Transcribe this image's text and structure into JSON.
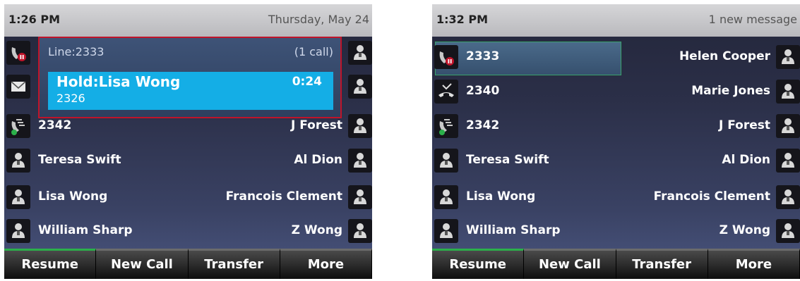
{
  "screens": [
    {
      "time": "1:26 PM",
      "status_info": "Thursday, May 24",
      "call": {
        "line_label": "Line:2333",
        "call_count": "(1 call)",
        "hold_name": "Hold:Lisa Wong",
        "hold_number": "2326",
        "duration": "0:24"
      },
      "rows": [
        {
          "left_icon": "line-hold-icon",
          "left_label": "",
          "right_label": "",
          "right_icon": "contact-icon"
        },
        {
          "left_icon": "envelope-icon",
          "left_label": "",
          "right_label": "",
          "right_icon": "contact-icon"
        },
        {
          "left_icon": "line-idle-icon",
          "left_label": "2342",
          "right_label": "J Forest",
          "right_icon": "contact-icon"
        },
        {
          "left_icon": "contact-icon",
          "left_label": "Teresa Swift",
          "right_label": "Al Dion",
          "right_icon": "contact-icon"
        },
        {
          "left_icon": "contact-icon",
          "left_label": "Lisa Wong",
          "right_label": "Francois Clement",
          "right_icon": "contact-icon"
        },
        {
          "left_icon": "contact-icon",
          "left_label": "William Sharp",
          "right_label": "Z Wong",
          "right_icon": "contact-icon"
        }
      ],
      "softkeys": [
        "Resume",
        "New Call",
        "Transfer",
        "More"
      ]
    },
    {
      "time": "1:32 PM",
      "status_info": "1 new message",
      "rows": [
        {
          "left_icon": "line-hold-icon",
          "left_label": "2333",
          "right_label": "Helen Cooper",
          "right_icon": "contact-icon"
        },
        {
          "left_icon": "missed-call-icon",
          "left_label": "2340",
          "right_label": "Marie Jones",
          "right_icon": "contact-icon"
        },
        {
          "left_icon": "line-idle-icon",
          "left_label": "2342",
          "right_label": "J Forest",
          "right_icon": "contact-icon"
        },
        {
          "left_icon": "contact-icon",
          "left_label": "Teresa Swift",
          "right_label": "Al Dion",
          "right_icon": "contact-icon"
        },
        {
          "left_icon": "contact-icon",
          "left_label": "Lisa Wong",
          "right_label": "Francois Clement",
          "right_icon": "contact-icon"
        },
        {
          "left_icon": "contact-icon",
          "left_label": "William Sharp",
          "right_label": "Z Wong",
          "right_icon": "contact-icon"
        }
      ],
      "softkeys": [
        "Resume",
        "New Call",
        "Transfer",
        "More"
      ]
    }
  ],
  "colors": {
    "hold_highlight": "#14aee6",
    "call_border": "#c0142a",
    "selection_border": "#3aa36c",
    "softkey_active": "#2bb04a"
  }
}
